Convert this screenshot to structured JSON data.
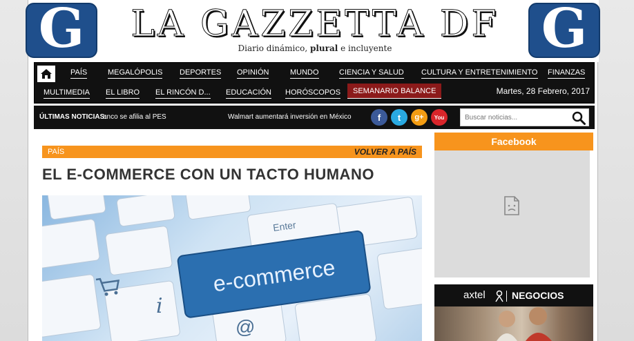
{
  "masthead": {
    "logo_letter": "G",
    "title": "LA GAZZETTA DF",
    "tagline_pre": "Diario dinámico, ",
    "tagline_bold": "plural",
    "tagline_post": " e incluyente"
  },
  "nav": {
    "row1": [
      "PAÍS",
      "MEGALÓPOLIS",
      "DEPORTES",
      "OPINIÓN",
      "MUNDO",
      "CIENCIA Y SALUD",
      "CULTURA Y ENTRETENIMIENTO",
      "FINANZAS"
    ],
    "row2": [
      "MULTIMEDIA",
      "EL LIBRO",
      "EL RINCÓN D...",
      "EDUCACIÓN",
      "HORÓSCOPOS",
      "SEMANARIO BALANCE"
    ],
    "date": "Martes, 28 Febrero, 2017"
  },
  "ticker": {
    "label": "ÚLTIMAS NOTICIAS:",
    "item1": "anco se afilia al PES",
    "item2": "Walmart aumentará inversión en México"
  },
  "social": [
    {
      "name": "facebook",
      "glyph": "f",
      "color": "#3b5998"
    },
    {
      "name": "twitter",
      "glyph": "t",
      "color": "#29a9e1"
    },
    {
      "name": "google-plus",
      "glyph": "g+",
      "color": "#f39c12"
    },
    {
      "name": "youtube",
      "glyph": "You",
      "color": "#d9252a"
    }
  ],
  "search": {
    "placeholder": "Buscar noticias..."
  },
  "article": {
    "section": "PAÍS",
    "back_link": "VOLVER A PAÍS",
    "title": "EL E-COMMERCE CON UN TACTO HUMANO",
    "hero_text": "e-commerce",
    "enter_key": "Enter"
  },
  "sidebar": {
    "header": "Facebook",
    "ad_brand": "axtel",
    "ad_label": "NEGOCIOS"
  }
}
